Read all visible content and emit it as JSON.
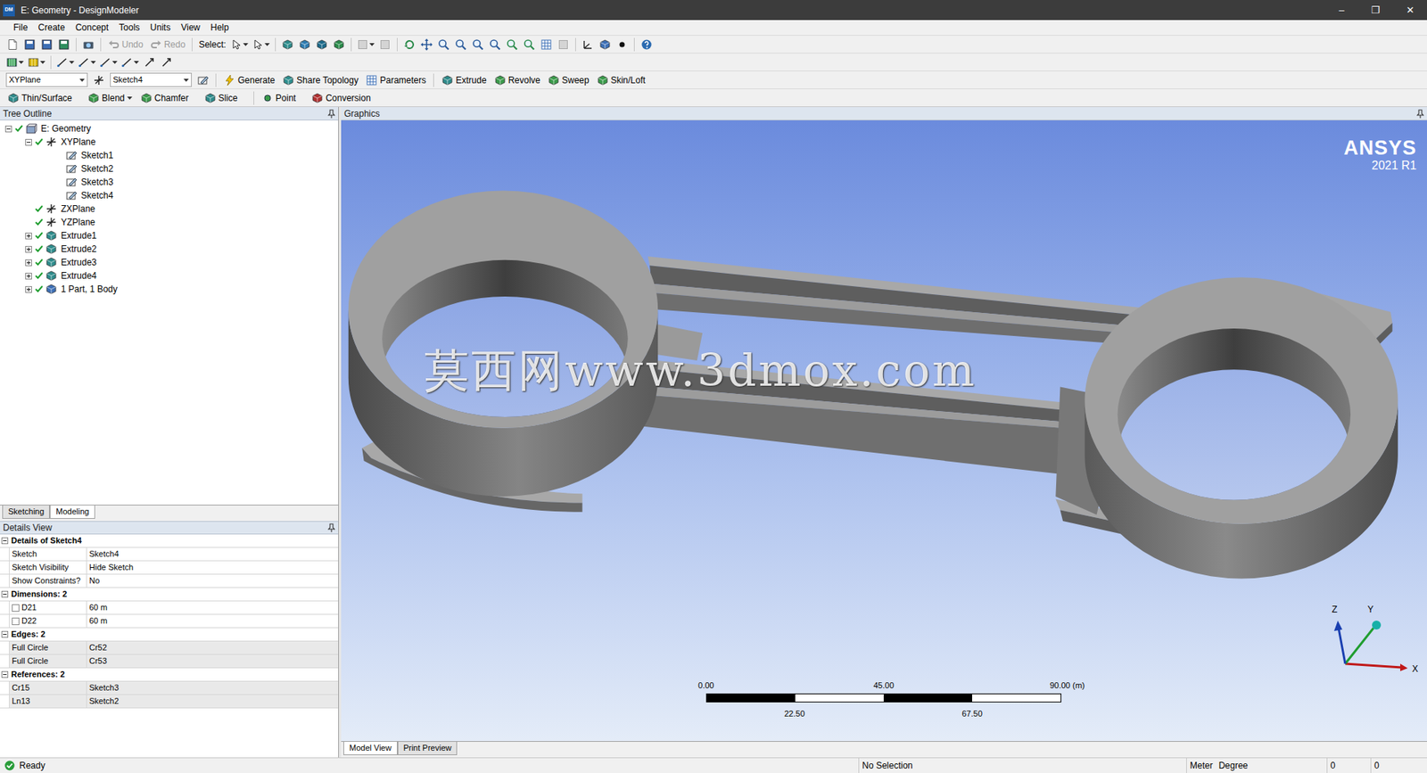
{
  "window": {
    "app_icon": "DM",
    "title": "E: Geometry - DesignModeler",
    "controls": [
      "–",
      "❐",
      "✕"
    ]
  },
  "menu": [
    "File",
    "Create",
    "Concept",
    "Tools",
    "Units",
    "View",
    "Help"
  ],
  "toolbar": {
    "undo": {
      "label": "Undo",
      "disabled": true
    },
    "redo": {
      "label": "Redo",
      "disabled": true
    },
    "select_label": "Select:"
  },
  "feature_bar": {
    "plane": "XYPlane",
    "sketch": "Sketch4",
    "buttons": [
      {
        "label": "Generate",
        "kind": "generate"
      },
      {
        "label": "Share Topology",
        "kind": "share"
      },
      {
        "label": "Parameters",
        "kind": "parameters"
      },
      {
        "label": "Extrude",
        "kind": "extrude"
      },
      {
        "label": "Revolve",
        "kind": "revolve"
      },
      {
        "label": "Sweep",
        "kind": "sweep"
      },
      {
        "label": "Skin/Loft",
        "kind": "skin"
      }
    ]
  },
  "feature_bar2": [
    {
      "label": "Thin/Surface",
      "kind": "thin",
      "dropdown": false
    },
    {
      "label": "Blend",
      "kind": "blend",
      "dropdown": true
    },
    {
      "label": "Chamfer",
      "kind": "chamfer",
      "dropdown": false
    },
    {
      "label": "Slice",
      "kind": "slice",
      "dropdown": false
    },
    {
      "label": "Point",
      "kind": "point",
      "dropdown": false
    },
    {
      "label": "Conversion",
      "kind": "conversion",
      "dropdown": false
    }
  ],
  "tree": {
    "header": "Tree Outline",
    "items": [
      {
        "label": "E: Geometry",
        "kind": "geometry",
        "depth": 0,
        "expandable": true,
        "expanded": true,
        "checked": true
      },
      {
        "label": "XYPlane",
        "kind": "plane",
        "depth": 1,
        "expandable": true,
        "expanded": true,
        "checked": true
      },
      {
        "label": "Sketch1",
        "kind": "sketch",
        "depth": 2,
        "expandable": false,
        "expanded": false,
        "checked": false
      },
      {
        "label": "Sketch2",
        "kind": "sketch",
        "depth": 2,
        "expandable": false,
        "expanded": false,
        "checked": false
      },
      {
        "label": "Sketch3",
        "kind": "sketch",
        "depth": 2,
        "expandable": false,
        "expanded": false,
        "checked": false
      },
      {
        "label": "Sketch4",
        "kind": "sketch",
        "depth": 2,
        "expandable": false,
        "expanded": false,
        "checked": false
      },
      {
        "label": "ZXPlane",
        "kind": "plane",
        "depth": 1,
        "expandable": false,
        "expanded": false,
        "checked": true
      },
      {
        "label": "YZPlane",
        "kind": "plane",
        "depth": 1,
        "expandable": false,
        "expanded": false,
        "checked": true
      },
      {
        "label": "Extrude1",
        "kind": "extrude",
        "depth": 1,
        "expandable": true,
        "expanded": false,
        "checked": true
      },
      {
        "label": "Extrude2",
        "kind": "extrude",
        "depth": 1,
        "expandable": true,
        "expanded": false,
        "checked": true
      },
      {
        "label": "Extrude3",
        "kind": "extrude",
        "depth": 1,
        "expandable": true,
        "expanded": false,
        "checked": true
      },
      {
        "label": "Extrude4",
        "kind": "extrude",
        "depth": 1,
        "expandable": true,
        "expanded": false,
        "checked": true
      },
      {
        "label": "1 Part, 1 Body",
        "kind": "body",
        "depth": 1,
        "expandable": true,
        "expanded": false,
        "checked": true
      }
    ]
  },
  "panel_tabs": [
    {
      "label": "Sketching",
      "selected": false
    },
    {
      "label": "Modeling",
      "selected": true
    }
  ],
  "details": {
    "header": "Details View",
    "sections": [
      {
        "title": "Details of Sketch4",
        "expanded": true,
        "rows": [
          {
            "label": "Sketch",
            "value": "Sketch4",
            "kind": "text",
            "readonly": false
          },
          {
            "label": "Sketch Visibility",
            "value": "Hide Sketch",
            "kind": "text",
            "readonly": false
          },
          {
            "label": "Show Constraints?",
            "value": "No",
            "kind": "text",
            "readonly": false
          }
        ]
      },
      {
        "title": "Dimensions: 2",
        "expanded": true,
        "rows": [
          {
            "label": "D21",
            "value": "60 m",
            "kind": "checkbox",
            "checked": false,
            "readonly": false
          },
          {
            "label": "D22",
            "value": "60 m",
            "kind": "checkbox",
            "checked": false,
            "readonly": false
          }
        ]
      },
      {
        "title": "Edges: 2",
        "expanded": true,
        "rows": [
          {
            "label": "Full Circle",
            "value": "Cr52",
            "kind": "text",
            "readonly": true
          },
          {
            "label": "Full Circle",
            "value": "Cr53",
            "kind": "text",
            "readonly": true
          }
        ]
      },
      {
        "title": "References: 2",
        "expanded": true,
        "rows": [
          {
            "label": "Cr15",
            "value": "Sketch3",
            "kind": "text",
            "readonly": true
          },
          {
            "label": "Ln13",
            "value": "Sketch2",
            "kind": "text",
            "readonly": true
          }
        ]
      }
    ]
  },
  "graphics": {
    "header": "Graphics",
    "logo": {
      "brand": "ANSYS",
      "version": "2021 R1"
    },
    "watermark": "莫西网www.3dmox.com",
    "scale": {
      "upper": [
        "0.00",
        "45.00",
        "90.00 (m)"
      ],
      "lower": [
        "22.50",
        "67.50"
      ]
    },
    "axes": {
      "z": "Z",
      "y": "Y",
      "x": "X"
    }
  },
  "view_tabs": [
    {
      "label": "Model View",
      "selected": true
    },
    {
      "label": "Print Preview",
      "selected": false
    }
  ],
  "status_bar": {
    "message": "Ready",
    "selection": "No Selection",
    "length_unit": "Meter",
    "angle_unit": "Degree",
    "x": "0",
    "y": "0"
  }
}
